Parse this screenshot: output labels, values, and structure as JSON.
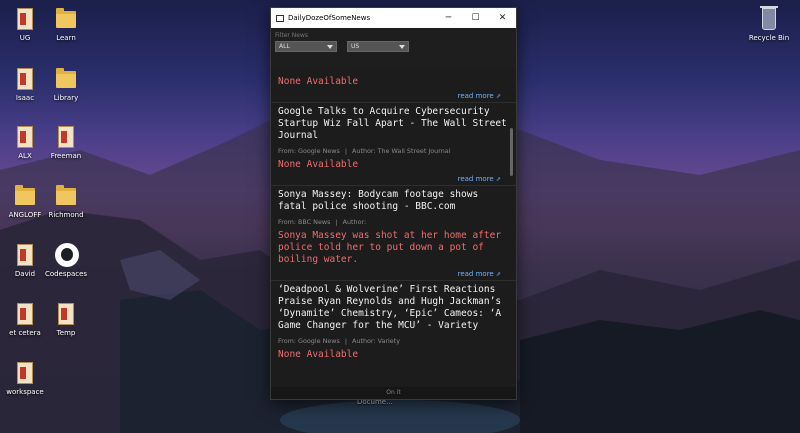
{
  "desktop": {
    "icons": [
      {
        "label": "UG",
        "icon": "folder-icon"
      },
      {
        "label": "Learn",
        "icon": "folder-icon"
      },
      {
        "label": "Isaac",
        "icon": "document-icon"
      },
      {
        "label": "Library",
        "icon": "folder-icon"
      },
      {
        "label": "ALX",
        "icon": "document-icon"
      },
      {
        "label": "Freeman",
        "icon": "document-icon"
      },
      {
        "label": "ANGLOFF",
        "icon": "folder-icon"
      },
      {
        "label": "Richmond",
        "icon": "folder-icon"
      },
      {
        "label": "David",
        "icon": "document-icon"
      },
      {
        "label": "Codespaces",
        "icon": "github-icon"
      },
      {
        "label": "et cetera",
        "icon": "document-icon"
      },
      {
        "label": "Temp",
        "icon": "document-icon"
      },
      {
        "label": "workspace",
        "icon": "document-icon"
      },
      {
        "label": "Recycle Bin",
        "icon": "recycle-bin-icon"
      }
    ],
    "background_text": "Docume..."
  },
  "window": {
    "title": "DailyDozeOfSomeNews",
    "minimize": "─",
    "maximize": "☐",
    "close": "✕"
  },
  "filters": {
    "label": "Filter News",
    "category": "ALL",
    "country": "US"
  },
  "articles": [
    {
      "title": "",
      "meta_from": "",
      "meta_author": "",
      "description": "None Available",
      "read_more": "read more"
    },
    {
      "title": "Google Talks to Acquire Cybersecurity Startup Wiz Fall Apart - The Wall Street Journal",
      "meta_from": "From: Google News",
      "meta_author": "Author: The Wall Street Journal",
      "description": "None Available",
      "read_more": "read more"
    },
    {
      "title": "Sonya Massey: Bodycam footage shows fatal police shooting - BBC.com",
      "meta_from": "From: BBC News",
      "meta_author": "Author:",
      "description": "Sonya Massey was shot at her home after police told her to put down a pot of boiling water.",
      "read_more": "read more"
    },
    {
      "title": "‘Deadpool & Wolverine’ First Reactions Praise Ryan Reynolds and Hugh Jackman’s ‘Dynamite’ Chemistry, ‘Epic’ Cameos: ‘A Game Changer for the MCU’ - Variety",
      "meta_from": "From: Google News",
      "meta_author": "Author: Variety",
      "description": "None Available",
      "read_more": ""
    }
  ],
  "status": "On it",
  "colors": {
    "title_text": "#f2f2f2",
    "description_text": "#ef6d6d",
    "link": "#6cb4ff",
    "window_bg": "#1c1c1c"
  }
}
